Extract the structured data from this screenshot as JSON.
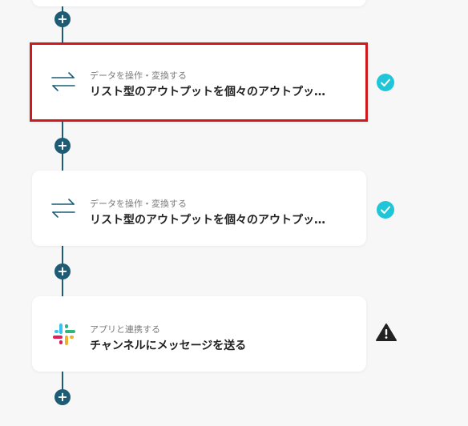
{
  "flow": {
    "steps": [
      {
        "category": "データを操作・変換する",
        "title": "リスト型のアウトプットを個々のアウトプッ…",
        "status": "success",
        "icon": "convert-arrows-icon",
        "selected": true
      },
      {
        "category": "データを操作・変換する",
        "title": "リスト型のアウトプットを個々のアウトプッ…",
        "status": "success",
        "icon": "convert-arrows-icon",
        "selected": false
      },
      {
        "category": "アプリと連携する",
        "title": "チャンネルにメッセージを送る",
        "status": "warning",
        "icon": "slack-icon",
        "selected": false
      }
    ],
    "add_button_label": "+"
  },
  "colors": {
    "rail": "#1d5c74",
    "selected_border": "#d0191c",
    "success": "#1fc6d8",
    "warning": "#222222"
  }
}
